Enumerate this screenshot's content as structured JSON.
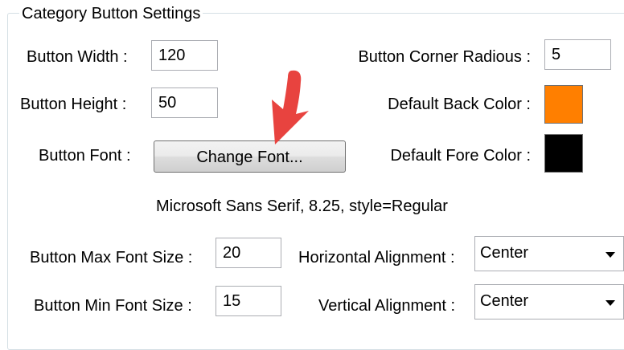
{
  "group": {
    "title": "Category Button Settings"
  },
  "fields": {
    "button_width": {
      "label": "Button Width :",
      "value": "120"
    },
    "button_height": {
      "label": "Button Height :",
      "value": "50"
    },
    "button_font": {
      "label": "Button Font :",
      "button_label": "Change Font..."
    },
    "corner_radius": {
      "label": "Button Corner Radious :",
      "value": "5"
    },
    "back_color": {
      "label": "Default Back Color :",
      "color": "#ff7f00"
    },
    "fore_color": {
      "label": "Default Fore Color :",
      "color": "#000000"
    },
    "font_description": "Microsoft Sans Serif, 8.25, style=Regular",
    "max_font_size": {
      "label": "Button Max Font Size :",
      "value": "20"
    },
    "min_font_size": {
      "label": "Button Min Font Size :",
      "value": "15"
    },
    "horizontal_alignment": {
      "label": "Horizontal Alignment :",
      "value": "Center"
    },
    "vertical_alignment": {
      "label": "Vertical Alignment :",
      "value": "Center"
    }
  },
  "annotation": {
    "arrow_color": "#e8433f"
  }
}
